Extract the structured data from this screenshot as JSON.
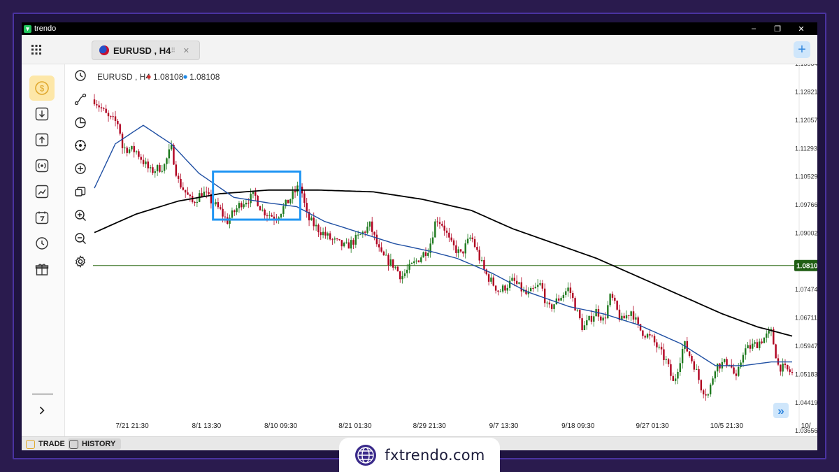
{
  "window": {
    "app_name": "trendo",
    "minimize": "–",
    "restore": "❐",
    "close": "✕"
  },
  "tab": {
    "label": "EURUSD , H4",
    "drag_glyph": "⠿",
    "close_glyph": "✕",
    "add_glyph": "+"
  },
  "colors": {
    "ma_fast": "#1f4fa3",
    "ma_slow": "#000000",
    "price_line": "#2e6b16",
    "price_tag_bg": "#1f5d13",
    "highlight_box": "#2196f3",
    "bid_dot": "#d32f2f",
    "ask_dot": "#1e88e5",
    "candle_up": "#1f7a1f",
    "candle_down": "#b00020",
    "accent": "#f4c542"
  },
  "sidebar": {
    "items": [
      {
        "name": "dollar-icon",
        "active": true
      },
      {
        "name": "deposit-icon",
        "active": false
      },
      {
        "name": "withdraw-icon",
        "active": false
      },
      {
        "name": "signal-icon",
        "active": false
      },
      {
        "name": "analytics-icon",
        "active": false
      },
      {
        "name": "calendar-icon",
        "active": false
      },
      {
        "name": "history-icon",
        "active": false
      },
      {
        "name": "gift-icon",
        "active": false
      }
    ],
    "expand_icon": "chevron-right-icon"
  },
  "toolbar": {
    "tools": [
      "clock-icon",
      "trendline-icon",
      "pie-icon",
      "crosshair-icon",
      "add-circle-icon",
      "layers-icon",
      "zoom-in-icon",
      "zoom-out-icon",
      "gear-icon"
    ]
  },
  "bottom_tabs": [
    {
      "label": "TRADE",
      "icon": "trade-icon"
    },
    {
      "label": "HISTORY",
      "icon": "history-icon"
    }
  ],
  "watermark": {
    "text": "fxtrendo.com",
    "icon": "globe-icon"
  },
  "scroll_button": {
    "glyph": "»"
  },
  "chart_data": {
    "type": "candlestick",
    "legend": {
      "symbol": "EURUSD , H4",
      "bid": "1.08108",
      "ask": "1.08108"
    },
    "current_price": 1.08108,
    "current_price_label": "1.08108",
    "ylim": [
      1.0362,
      1.1355
    ],
    "y_ticks": [
      "1.13584",
      "1.12821",
      "1.12057",
      "1.11293",
      "1.10529",
      "1.09766",
      "1.09002",
      "1.07474",
      "1.06711",
      "1.05947",
      "1.05183",
      "1.04419",
      "1.03656"
    ],
    "x_ticks": [
      "7/21 21:30",
      "8/1 13:30",
      "8/10 09:30",
      "8/21 01:30",
      "8/29 21:30",
      "9/7 13:30",
      "9/18 09:30",
      "9/27 01:30",
      "10/5 21:30",
      "10/"
    ],
    "price_path": [
      [
        0,
        1.126
      ],
      [
        0.02,
        1.121
      ],
      [
        0.035,
        1.1195
      ],
      [
        0.04,
        1.113
      ],
      [
        0.06,
        1.112
      ],
      [
        0.08,
        1.1065
      ],
      [
        0.1,
        1.108
      ],
      [
        0.11,
        1.113
      ],
      [
        0.12,
        1.104
      ],
      [
        0.14,
        1.098
      ],
      [
        0.155,
        1.101
      ],
      [
        0.17,
        1.098
      ],
      [
        0.18,
        1.096
      ],
      [
        0.19,
        1.093
      ],
      [
        0.21,
        1.098
      ],
      [
        0.23,
        1.1
      ],
      [
        0.24,
        1.096
      ],
      [
        0.26,
        1.094
      ],
      [
        0.28,
        1.099
      ],
      [
        0.295,
        1.103
      ],
      [
        0.305,
        1.094
      ],
      [
        0.32,
        1.091
      ],
      [
        0.34,
        1.088
      ],
      [
        0.36,
        1.086
      ],
      [
        0.38,
        1.089
      ],
      [
        0.395,
        1.092
      ],
      [
        0.41,
        1.084
      ],
      [
        0.43,
        1.081
      ],
      [
        0.44,
        1.078
      ],
      [
        0.46,
        1.082
      ],
      [
        0.48,
        1.086
      ],
      [
        0.49,
        1.094
      ],
      [
        0.5,
        1.092
      ],
      [
        0.51,
        1.087
      ],
      [
        0.525,
        1.084
      ],
      [
        0.54,
        1.089
      ],
      [
        0.56,
        1.079
      ],
      [
        0.58,
        1.074
      ],
      [
        0.6,
        1.077
      ],
      [
        0.62,
        1.073
      ],
      [
        0.64,
        1.076
      ],
      [
        0.65,
        1.069
      ],
      [
        0.665,
        1.072
      ],
      [
        0.68,
        1.075
      ],
      [
        0.7,
        1.064
      ],
      [
        0.72,
        1.069
      ],
      [
        0.73,
        1.066
      ],
      [
        0.74,
        1.073
      ],
      [
        0.755,
        1.066
      ],
      [
        0.77,
        1.069
      ],
      [
        0.78,
        1.064
      ],
      [
        0.8,
        1.061
      ],
      [
        0.82,
        1.055
      ],
      [
        0.83,
        1.049
      ],
      [
        0.845,
        1.06
      ],
      [
        0.86,
        1.054
      ],
      [
        0.87,
        1.048
      ],
      [
        0.88,
        1.046
      ],
      [
        0.89,
        1.054
      ],
      [
        0.91,
        1.055
      ],
      [
        0.92,
        1.05
      ],
      [
        0.93,
        1.058
      ],
      [
        0.95,
        1.06
      ],
      [
        0.97,
        1.063
      ],
      [
        0.98,
        1.054
      ],
      [
        1.0,
        1.052
      ]
    ],
    "ma_fast": [
      [
        0,
        1.102
      ],
      [
        0.03,
        1.114
      ],
      [
        0.07,
        1.119
      ],
      [
        0.11,
        1.114
      ],
      [
        0.15,
        1.106
      ],
      [
        0.2,
        1.0995
      ],
      [
        0.25,
        1.098
      ],
      [
        0.29,
        1.097
      ],
      [
        0.33,
        1.093
      ],
      [
        0.38,
        1.09
      ],
      [
        0.43,
        1.087
      ],
      [
        0.48,
        1.085
      ],
      [
        0.52,
        1.083
      ],
      [
        0.57,
        1.079
      ],
      [
        0.62,
        1.074
      ],
      [
        0.68,
        1.07
      ],
      [
        0.73,
        1.068
      ],
      [
        0.78,
        1.065
      ],
      [
        0.84,
        1.06
      ],
      [
        0.89,
        1.054
      ],
      [
        0.93,
        1.054
      ],
      [
        0.97,
        1.055
      ],
      [
        1.0,
        1.055
      ]
    ],
    "ma_slow": [
      [
        0,
        1.09
      ],
      [
        0.06,
        1.095
      ],
      [
        0.12,
        1.0985
      ],
      [
        0.18,
        1.1005
      ],
      [
        0.25,
        1.1015
      ],
      [
        0.32,
        1.1015
      ],
      [
        0.4,
        1.101
      ],
      [
        0.47,
        1.099
      ],
      [
        0.54,
        1.096
      ],
      [
        0.6,
        1.091
      ],
      [
        0.66,
        1.087
      ],
      [
        0.72,
        1.083
      ],
      [
        0.78,
        1.078
      ],
      [
        0.84,
        1.073
      ],
      [
        0.9,
        1.068
      ],
      [
        0.95,
        1.0645
      ],
      [
        1.0,
        1.062
      ]
    ],
    "highlight": {
      "x0": 0.17,
      "x1": 0.295,
      "y0": 1.0935,
      "y1": 1.1065
    }
  }
}
